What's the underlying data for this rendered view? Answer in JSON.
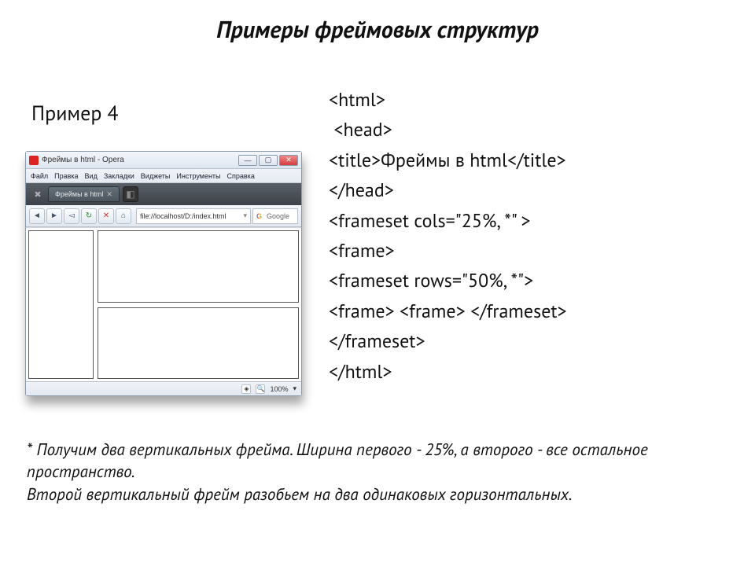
{
  "title": "Примеры фреймовых структур",
  "subtitle": "Пример 4",
  "code": {
    "l1": "<html>",
    "l2": " <head>",
    "l3": "<title>Фреймы в html</title>",
    "l4": "</head>",
    "l5": "<frameset cols=\"25%, *\" >",
    "l6": "<frame>",
    "l7": "<frameset rows=\"50%, *\">",
    "l8": "<frame> <frame> </frameset>",
    "l9": "</frameset>",
    "l10": "</html>"
  },
  "footnote": {
    "p1": "* Получим два вертикальных фрейма. Ширина первого - 25%, а второго - все остальное пространство.",
    "p2": "Второй вертикальный фрейм разобьем на два одинаковых горизонтальных."
  },
  "browser": {
    "window_title": "Фреймы в html - Opera",
    "menus": [
      "Файл",
      "Правка",
      "Вид",
      "Закладки",
      "Виджеты",
      "Инструменты",
      "Справка"
    ],
    "tab_label": "Фреймы в html",
    "address": "file://localhost/D:/index.html",
    "search_placeholder": "Google",
    "zoom": "100%"
  }
}
